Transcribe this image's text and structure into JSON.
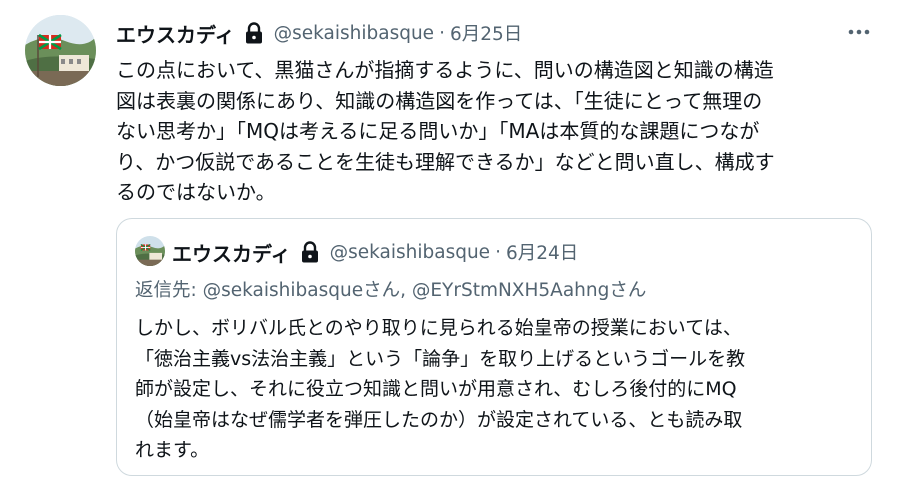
{
  "tweet": {
    "author_name": "エウスカディ",
    "author_handle": "@sekaishibasque",
    "separator": "·",
    "date": "6月25日",
    "avatar_icon": "basque-flag-avatar",
    "lock_icon": "lock-icon",
    "more_icon": "more-options-icon",
    "text_lines": [
      "この点において、黒猫さんが指摘するように、問いの構造図と知識の構造",
      "図は表裏の関係にあり、知識の構造図を作っては、「生徒にとって無理の",
      "ない思考か」「MQは考えるに足る問いか」「MAは本質的な課題につなが",
      "り、かつ仮説であることを生徒も理解できるか」などと問い直し、構成す",
      "るのではないか。"
    ]
  },
  "quoted": {
    "author_name": "エウスカディ",
    "author_handle": "@sekaishibasque",
    "separator": "·",
    "date": "6月24日",
    "replying_prefix": "返信先: ",
    "replying_user1": "@sekaishibasque",
    "san1": "さん, ",
    "replying_user2": "@EYrStmNXH5Aahng",
    "san2": "さん",
    "text_lines": [
      "しかし、ボリバル氏とのやり取りに見られる始皇帝の授業においては、",
      "「徳治主義vs法治主義」という「論争」を取り上げるというゴールを教",
      "師が設定し、それに役立つ知識と問いが用意され、むしろ後付的にMQ",
      "（始皇帝はなぜ儒学者を弾圧したのか）が設定されている、とも読み取",
      "れます。"
    ]
  },
  "colors": {
    "text": "#0f1419",
    "secondary": "#536471",
    "border": "#cfd9de",
    "flag_red": "#d52b1e",
    "flag_green": "#009b48"
  }
}
